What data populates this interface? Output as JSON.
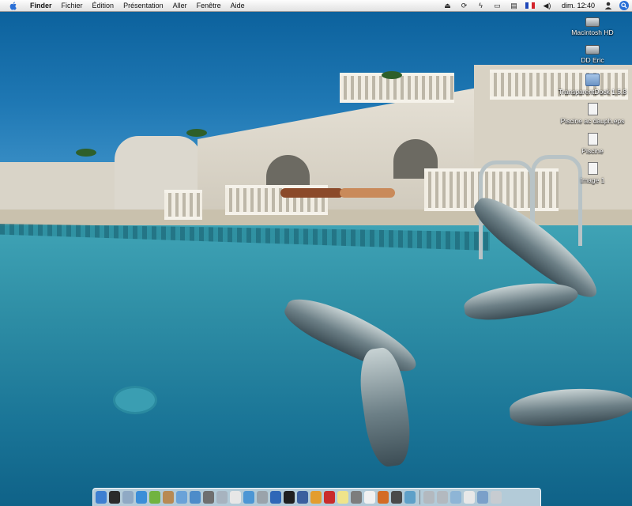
{
  "menubar": {
    "apple_icon": "apple-logo-icon",
    "app_name": "Finder",
    "menus": [
      "Fichier",
      "Édition",
      "Présentation",
      "Aller",
      "Fenêtre",
      "Aide"
    ],
    "status_icons": [
      "eject-icon",
      "sync-icon",
      "bolt-icon",
      "display-icon",
      "volume-dock-icon",
      "french-flag-icon",
      "speaker-icon"
    ],
    "clock": "dim. 12:40",
    "user_icon": "user-icon",
    "spotlight_icon": "spotlight-icon"
  },
  "desktop": {
    "icons": [
      {
        "label": "Macintosh HD",
        "icon": "hard-drive-icon"
      },
      {
        "label": "DD Eric",
        "icon": "hard-drive-icon"
      },
      {
        "label": "TransparentDock 1.5.8",
        "icon": "folder-icon"
      },
      {
        "label": "Piscine ac dauph.eps",
        "icon": "document-icon"
      },
      {
        "label": "Piscine",
        "icon": "document-icon"
      },
      {
        "label": "Image 1",
        "icon": "document-icon"
      }
    ]
  },
  "wallpaper": {
    "description_icon": "pool-dolphins-wallpaper"
  },
  "dock": {
    "apps": [
      {
        "name": "finder-icon",
        "color": "#3d7fd1"
      },
      {
        "name": "dashboard-icon",
        "color": "#2b2b2b"
      },
      {
        "name": "mail-icon",
        "color": "#8fa9c4"
      },
      {
        "name": "safari-icon",
        "color": "#3b8ed8"
      },
      {
        "name": "ichat-icon",
        "color": "#71b33f"
      },
      {
        "name": "address-book-icon",
        "color": "#b88a53"
      },
      {
        "name": "itunes-icon",
        "color": "#6aa2d8"
      },
      {
        "name": "iphoto-icon",
        "color": "#4d8cc9"
      },
      {
        "name": "imovie-icon",
        "color": "#6f6f6f"
      },
      {
        "name": "sherlock-icon",
        "color": "#a7b3bf"
      },
      {
        "name": "ical-icon",
        "color": "#e7e7e7"
      },
      {
        "name": "preview-icon",
        "color": "#4c96d4"
      },
      {
        "name": "system-preferences-icon",
        "color": "#9aa3ab"
      },
      {
        "name": "quicktime-icon",
        "color": "#2f67b7"
      },
      {
        "name": "terminal-icon",
        "color": "#1f1f1f"
      },
      {
        "name": "photoshop-icon",
        "color": "#3b5f9e"
      },
      {
        "name": "illustrator-icon",
        "color": "#e39d2e"
      },
      {
        "name": "acrobat-icon",
        "color": "#c92b2b"
      },
      {
        "name": "stickies-icon",
        "color": "#efe48a"
      },
      {
        "name": "calculator-icon",
        "color": "#7d7d7d"
      },
      {
        "name": "textedit-icon",
        "color": "#f1f1f1"
      },
      {
        "name": "firefox-icon",
        "color": "#d46b24"
      },
      {
        "name": "x11-icon",
        "color": "#4a4a4a"
      },
      {
        "name": "grapher-icon",
        "color": "#5ea0c8"
      }
    ],
    "docs": [
      {
        "name": "drive-icon",
        "color": "#b3b9bf"
      },
      {
        "name": "drive-icon",
        "color": "#b3b9bf"
      },
      {
        "name": "network-icon",
        "color": "#8eb5d6"
      },
      {
        "name": "document-icon",
        "color": "#e8e8e8"
      },
      {
        "name": "downloads-icon",
        "color": "#7aa0c9"
      },
      {
        "name": "trash-icon",
        "color": "#c7ccd1"
      }
    ]
  }
}
